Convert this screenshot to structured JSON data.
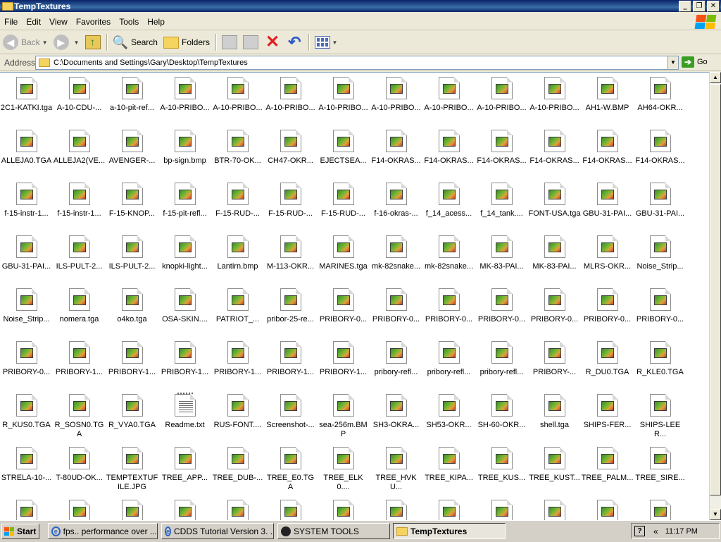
{
  "window": {
    "title": "TempTextures"
  },
  "menu": [
    "File",
    "Edit",
    "View",
    "Favorites",
    "Tools",
    "Help"
  ],
  "toolbar": {
    "back": "Back",
    "search": "Search",
    "folders": "Folders"
  },
  "address": {
    "label": "Address",
    "path": "C:\\Documents and Settings\\Gary\\Desktop\\TempTextures",
    "go": "Go"
  },
  "files": [
    [
      "2C1-KATKI.tga",
      "A-10-CDU-...",
      "a-10-pit-ref...",
      "A-10-PRIBO...",
      "A-10-PRIBO...",
      "A-10-PRIBO...",
      "A-10-PRIBO...",
      "A-10-PRIBO...",
      "A-10-PRIBO...",
      "A-10-PRIBO...",
      "A-10-PRIBO...",
      "AH1-W.BMP",
      "AH64-OKR..."
    ],
    [
      "ALLEJA0.TGA",
      "ALLEJA2(VE...",
      "AVENGER-...",
      "bp-sign.bmp",
      "BTR-70-OK...",
      "CH47-OKR...",
      "EJECTSEA...",
      "F14-OKRAS...",
      "F14-OKRAS...",
      "F14-OKRAS...",
      "F14-OKRAS...",
      "F14-OKRAS...",
      "F14-OKRAS..."
    ],
    [
      "f-15-instr-1...",
      "f-15-instr-1...",
      "F-15-KNOP...",
      "f-15-pit-refl...",
      "F-15-RUD-...",
      "F-15-RUD-...",
      "F-15-RUD-...",
      "f-16-okras-...",
      "f_14_acess...",
      "f_14_tank....",
      "FONT-USA.tga",
      "GBU-31-PAI...",
      "GBU-31-PAI..."
    ],
    [
      "GBU-31-PAI...",
      "ILS-PULT-2...",
      "ILS-PULT-2...",
      "knopki-light...",
      "Lantirn.bmp",
      "M-113-OKR...",
      "MARINES.tga",
      "mk-82snake...",
      "mk-82snake...",
      "MK-83-PAI...",
      "MK-83-PAI...",
      "MLRS-OKR...",
      "Noise_Strip..."
    ],
    [
      "Noise_Strip...",
      "nomera.tga",
      "o4ko.tga",
      "OSA-SKIN....",
      "PATRIOT_...",
      "pribor-25-re...",
      "PRIBORY-0...",
      "PRIBORY-0...",
      "PRIBORY-0...",
      "PRIBORY-0...",
      "PRIBORY-0...",
      "PRIBORY-0...",
      "PRIBORY-0..."
    ],
    [
      "PRIBORY-0...",
      "PRIBORY-1...",
      "PRIBORY-1...",
      "PRIBORY-1...",
      "PRIBORY-1...",
      "PRIBORY-1...",
      "PRIBORY-1...",
      "pribory-refl...",
      "pribory-refl...",
      "pribory-refl...",
      "PRIBORY-...",
      "R_DU0.TGA",
      "R_KLE0.TGA"
    ],
    [
      "R_KUS0.TGA",
      "R_SOSN0.TGA",
      "R_VYA0.TGA",
      "Readme.txt",
      "RUS-FONT....",
      "Screenshot-...",
      "sea-256m.BMP",
      "SH3-OKRA...",
      "SH53-OKR...",
      "SH-60-OKR...",
      "shell.tga",
      "SHIPS-FER...",
      "SHIPS-LEER..."
    ],
    [
      "STRELA-10-...",
      "T-80UD-OK...",
      "TEMPTEXTUFILE.JPG",
      "TREE_APP...",
      "TREE_DUB-...",
      "TREE_E0.TGA",
      "TREE_ELK0....",
      "TREE_HVKU...",
      "TREE_KIPA...",
      "TREE_KUS...",
      "TREE_KUST...",
      "TREE_PALM...",
      "TREE_SIRE..."
    ],
    [
      "",
      "",
      "",
      "",
      "",
      "",
      "",
      "",
      "",
      "",
      "",
      "",
      ""
    ]
  ],
  "taskbar": {
    "start": "Start",
    "tasks": [
      "fps.. performance over ...",
      "CDDS Tutorial Version 3. ...",
      "SYSTEM TOOLS",
      "TempTextures"
    ],
    "clock": "11:17 PM"
  }
}
